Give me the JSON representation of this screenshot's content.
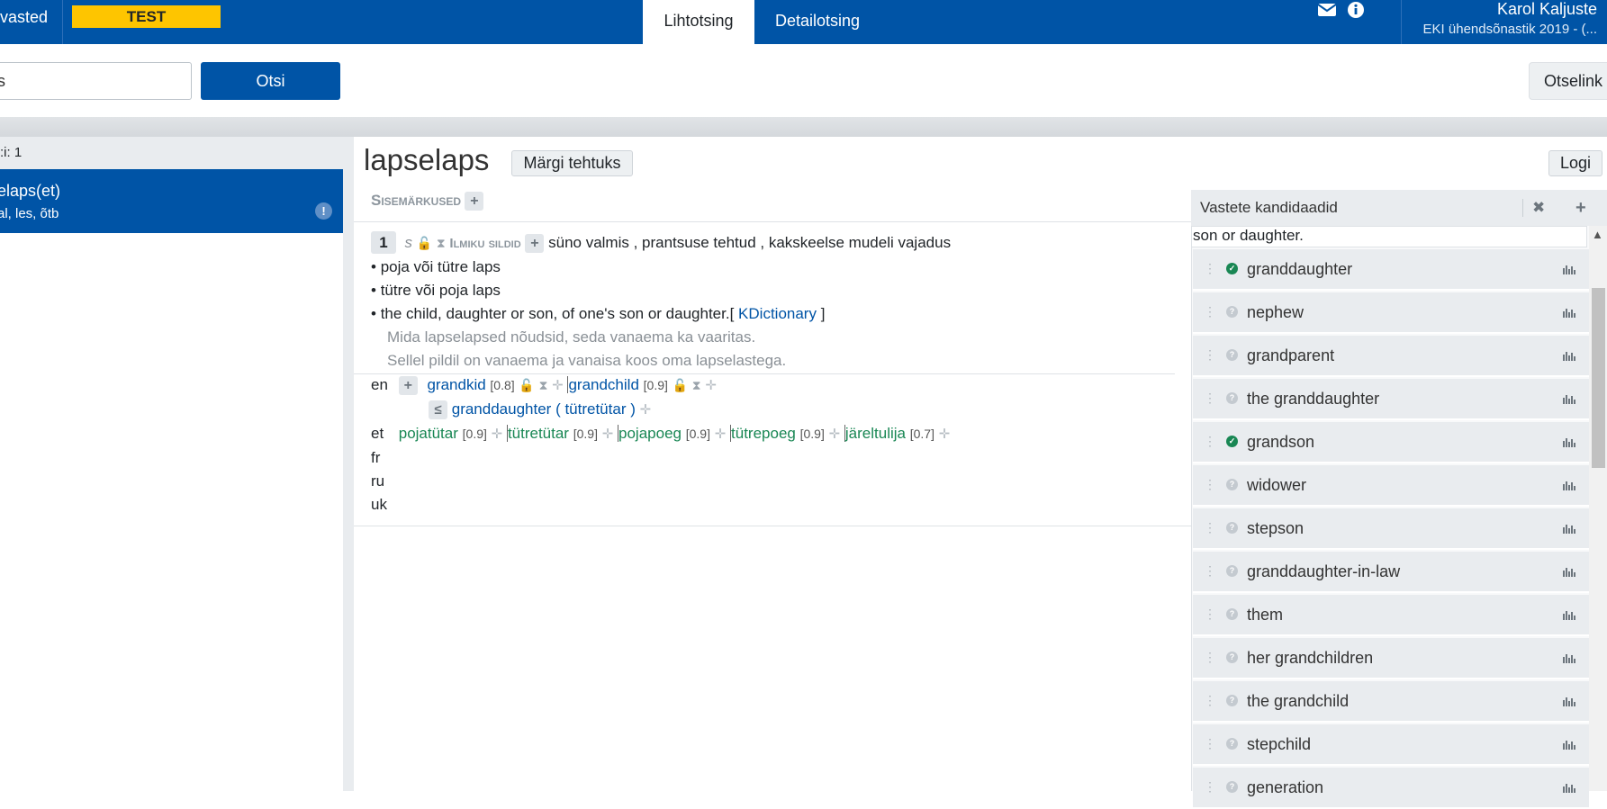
{
  "topbar": {
    "nav_left": "vasted",
    "test_badge": "TEST",
    "tabs": [
      {
        "label": "Lihtotsing"
      },
      {
        "label": "Detailotsing"
      }
    ],
    "user_name": "Karol Kaljuste",
    "user_dict": "EKI ühendsõnastik 2019 - (..."
  },
  "search": {
    "value": "s",
    "button": "Otsi",
    "otselink": "Otselink"
  },
  "left": {
    "count": ":i: 1",
    "item_title": "elaps(et)",
    "item_sub": "al, les, õtb",
    "item_alert": "!"
  },
  "main": {
    "word": "lapselaps",
    "mark_done": "Märgi tehtuks",
    "log": "Logi",
    "notes_label": "Sisemärkused",
    "meaning": {
      "number": "1",
      "pos": "s",
      "tags_label": "Ilmiku sildid",
      "tags": "süno valmis , prantsuse tehtud , kakskeelse mudeli vajadus",
      "definitions": [
        "poja või tütre laps",
        "tütre või poja laps",
        "the child, daughter or son, of one's son or daughter.["
      ],
      "source": "KDictionary",
      "source_close": "]",
      "examples": [
        "Mida lapselapsed nõudsid, seda vanaema ka vaaritas.",
        "Sellel pildil on vanaema ja vanaisa koos oma lapselastega."
      ]
    },
    "translations": {
      "en_lang": "en",
      "en": [
        {
          "word": "grandkid",
          "weight": "[0.8]"
        },
        {
          "word": "grandchild",
          "weight": "[0.9]"
        }
      ],
      "en_sub_sign": "≤",
      "en_sub_word": "granddaughter",
      "en_sub_paren": "( tütretütar )",
      "et_lang": "et",
      "et": [
        {
          "word": "pojatütar",
          "weight": "[0.9]"
        },
        {
          "word": "tütretütar",
          "weight": "[0.9]"
        },
        {
          "word": "pojapoeg",
          "weight": "[0.9]"
        },
        {
          "word": "tütrepoeg",
          "weight": "[0.9]"
        },
        {
          "word": "järeltulija",
          "weight": "[0.7]"
        }
      ],
      "other_langs": [
        "fr",
        "ru",
        "uk"
      ]
    }
  },
  "candidates": {
    "title": "Vastete kandidaadid",
    "close_icon": "✖",
    "plus_icon": "+",
    "text": "son or daughter.",
    "items": [
      {
        "word": "granddaughter",
        "status": "ok"
      },
      {
        "word": "nephew",
        "status": "q"
      },
      {
        "word": "grandparent",
        "status": "q"
      },
      {
        "word": "the granddaughter",
        "status": "q"
      },
      {
        "word": "grandson",
        "status": "ok"
      },
      {
        "word": "widower",
        "status": "q"
      },
      {
        "word": "stepson",
        "status": "q"
      },
      {
        "word": "granddaughter-in-law",
        "status": "q"
      },
      {
        "word": "them",
        "status": "q"
      },
      {
        "word": "her grandchildren",
        "status": "q"
      },
      {
        "word": "the grandchild",
        "status": "q"
      },
      {
        "word": "stepchild",
        "status": "q"
      },
      {
        "word": "generation",
        "status": "q"
      }
    ]
  },
  "colors": {
    "brand": "#0054a6",
    "badge": "#fec500",
    "ok": "#198754"
  }
}
